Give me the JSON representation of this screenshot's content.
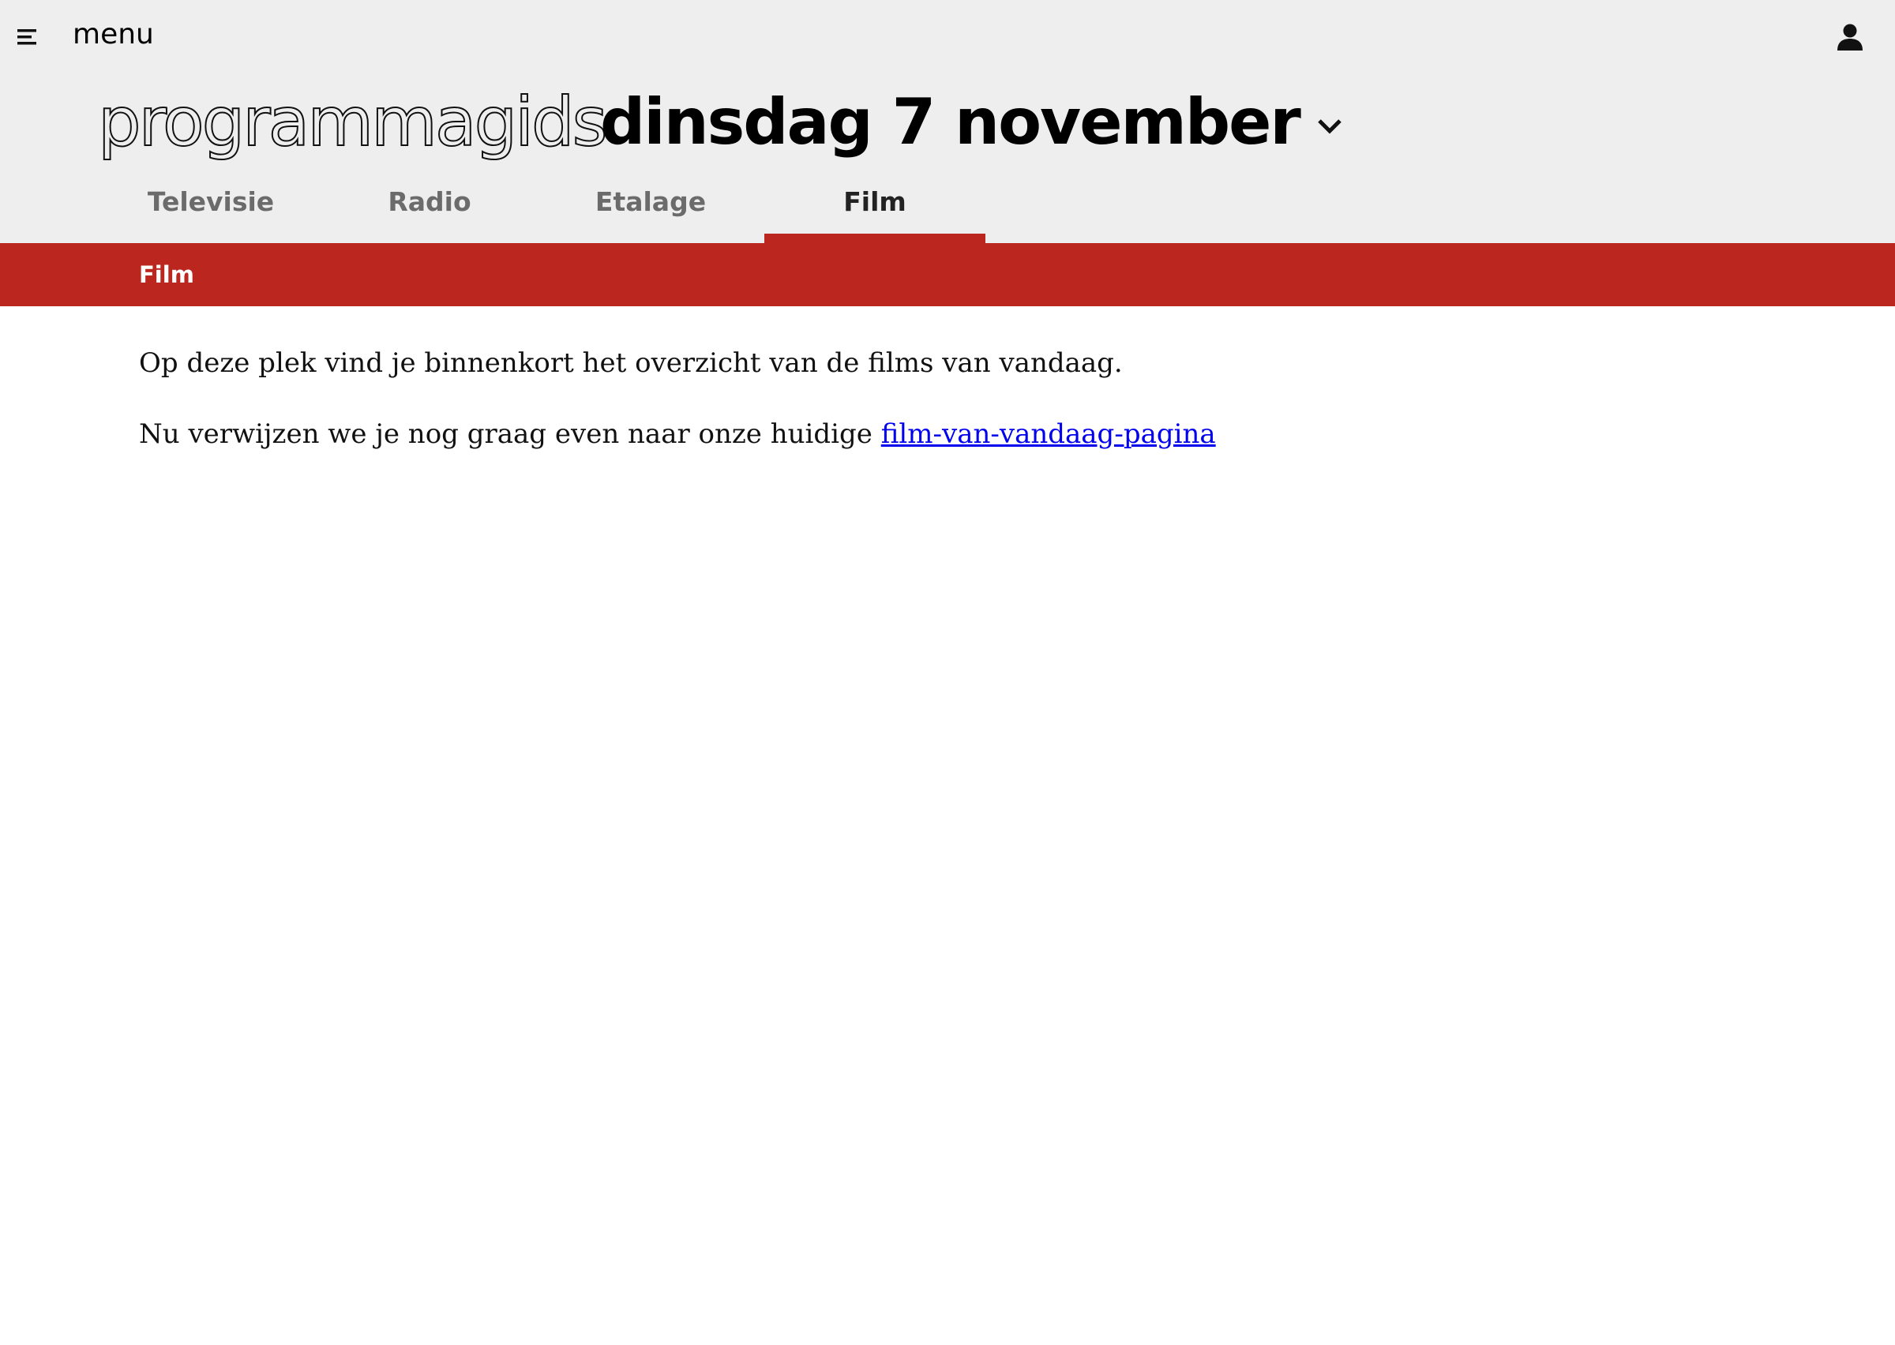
{
  "header": {
    "menu_icon": "hamburger-menu-icon",
    "menu_label": "menu",
    "user_icon": "user-account-icon",
    "site_title": "programmagids",
    "date_label": "dinsdag 7 november",
    "date_chevron_icon": "chevron-down-icon"
  },
  "tabs": [
    {
      "label": "Televisie",
      "active": false
    },
    {
      "label": "Radio",
      "active": false
    },
    {
      "label": "Etalage",
      "active": false
    },
    {
      "label": "Film",
      "active": true
    }
  ],
  "section": {
    "title": "Film"
  },
  "content": {
    "paragraph1": "Op deze plek vind je binnenkort het overzicht van de films van vandaag.",
    "paragraph2_prefix": "Nu verwijzen we je nog graag even naar onze huidige ",
    "link_text": "film-van-vandaag-pagina"
  },
  "colors": {
    "header_background": "#eeeeee",
    "accent_red": "#bb271e",
    "link": "#0000ee"
  }
}
